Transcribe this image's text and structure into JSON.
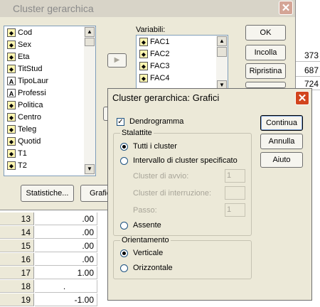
{
  "sheet": {
    "rows": [
      {
        "num": "13",
        "val": ".00"
      },
      {
        "num": "14",
        "val": ".00"
      },
      {
        "num": "15",
        "val": ".00"
      },
      {
        "num": "16",
        "val": ".00"
      },
      {
        "num": "17",
        "val": "1.00"
      },
      {
        "num": "18",
        "val": "."
      },
      {
        "num": "19",
        "val": "-1.00"
      }
    ],
    "right_col": [
      "373",
      "687",
      "724"
    ]
  },
  "main_dialog": {
    "title": "Cluster gerarchica",
    "close_glyph": "✕",
    "source_list": [
      {
        "icon": "ordinal",
        "label": "Cod"
      },
      {
        "icon": "ordinal",
        "label": "Sex"
      },
      {
        "icon": "ordinal",
        "label": "Eta"
      },
      {
        "icon": "ordinal",
        "label": "TitStud"
      },
      {
        "icon": "string",
        "label": "TipoLaur"
      },
      {
        "icon": "string",
        "label": "Professi"
      },
      {
        "icon": "ordinal",
        "label": "Politica"
      },
      {
        "icon": "ordinal",
        "label": "Centro"
      },
      {
        "icon": "ordinal",
        "label": "Teleg"
      },
      {
        "icon": "ordinal",
        "label": "Quotid"
      },
      {
        "icon": "ordinal",
        "label": "T1"
      },
      {
        "icon": "ordinal",
        "label": "T2"
      }
    ],
    "variables_label": "Variabili:",
    "variables_list": [
      {
        "icon": "ordinal",
        "label": "FAC1"
      },
      {
        "icon": "ordinal",
        "label": "FAC2"
      },
      {
        "icon": "ordinal",
        "label": "FAC3"
      },
      {
        "icon": "ordinal",
        "label": "FAC4"
      }
    ],
    "buttons": {
      "ok": "OK",
      "paste": "Incolla",
      "reset": "Ripristina",
      "statistics": "Statistiche...",
      "plots": "Grafic"
    }
  },
  "plots_dialog": {
    "title": "Cluster gerarchica: Grafici",
    "close_glyph": "✕",
    "dendrogram_label": "Dendrogramma",
    "dendrogram_checked": true,
    "icicle_group_label": "Stalattite",
    "icicle_options": {
      "all": "Tutti i cluster",
      "range": "Intervallo di cluster specificato",
      "none": "Assente"
    },
    "range_fields": {
      "start_label": "Cluster di avvio:",
      "start_value": "1",
      "stop_label": "Cluster di interruzione:",
      "stop_value": "",
      "step_label": "Passo:",
      "step_value": "1"
    },
    "orientation_group_label": "Orientamento",
    "orientation_options": {
      "vertical": "Verticale",
      "horizontal": "Orizzontale"
    },
    "buttons": {
      "continue": "Continua",
      "cancel": "Annulla",
      "help": "Aiuto"
    }
  }
}
